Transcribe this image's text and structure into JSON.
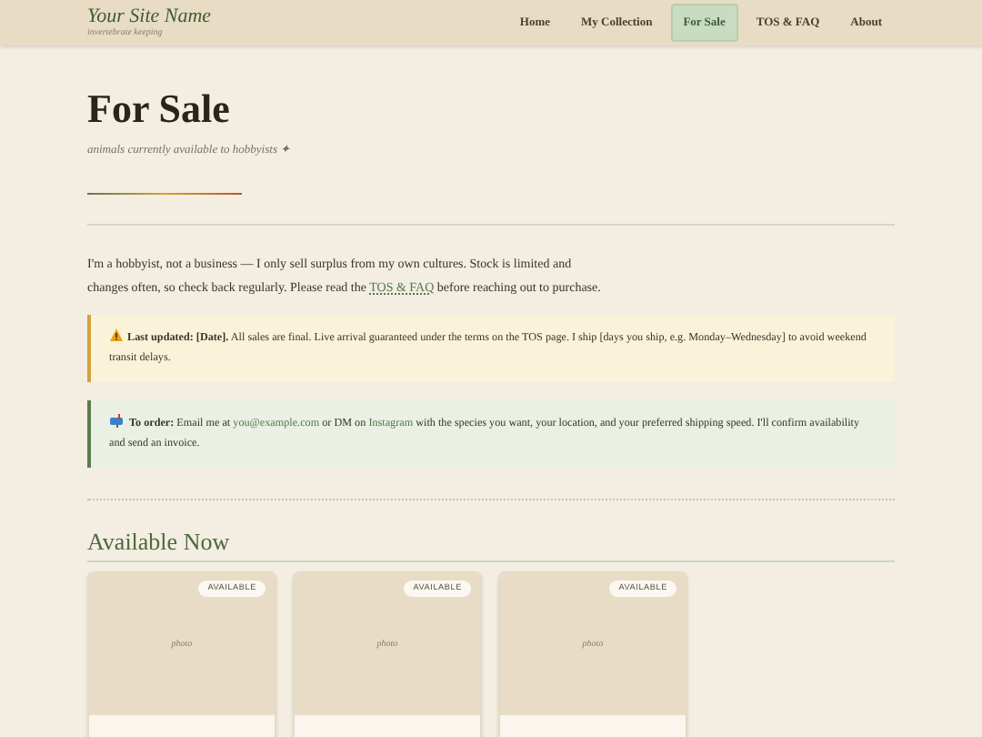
{
  "site": {
    "name": "Your Site Name",
    "tagline": "invertebrate keeping"
  },
  "nav": [
    {
      "label": "Home",
      "selected": false
    },
    {
      "label": "My Collection",
      "selected": false
    },
    {
      "label": "For Sale",
      "selected": true
    },
    {
      "label": "TOS & FAQ",
      "selected": false
    },
    {
      "label": "About",
      "selected": false
    }
  ],
  "page": {
    "title": "For Sale",
    "subtitle": "animals currently available to hobbyists ✦"
  },
  "intro": {
    "before": "I'm a hobbyist, not a business — I only sell surplus from my own cultures. Stock is limited and changes often, so check back regularly. Please read the",
    "link": "TOS & FAQ",
    "after": "before reaching out to purchase."
  },
  "notices": [
    {
      "kind": "warning",
      "parts": [
        {
          "kind": "text",
          "text": "**Last updated: [Date].** All sales are final. Live arrival guaranteed under the terms on the TOS page. I ship [days you ship, e.g. Monday–Wednesday] to avoid weekend transit delays."
        }
      ]
    },
    {
      "kind": "order",
      "parts": [
        {
          "kind": "text",
          "text": "**To order:** Email me at"
        },
        {
          "kind": "link",
          "text": "you@example.com"
        },
        {
          "kind": "text",
          "text": "or DM on"
        },
        {
          "kind": "link",
          "text": "Instagram"
        },
        {
          "kind": "text",
          "text": "with the species you want, your location, and your preferred shipping speed. I'll confirm availability and send an invoice."
        }
      ]
    }
  ],
  "section": {
    "title": "Available Now"
  },
  "cards": [
    {
      "badge": "AVAILABLE",
      "placeholder": "photo"
    },
    {
      "badge": "AVAILABLE",
      "placeholder": "photo"
    },
    {
      "badge": "AVAILABLE",
      "placeholder": "photo"
    }
  ]
}
